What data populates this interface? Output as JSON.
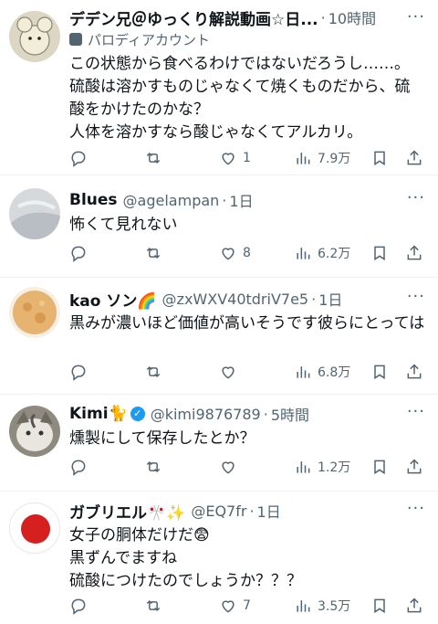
{
  "posts": [
    {
      "name": "デデン兄＠ゆっくり解説動画☆日...",
      "handle": "",
      "time": "10時間",
      "sub": "パロディアカウント",
      "text": "この状態から食べるわけではないだろうし……。\n硫酸は溶かすものじゃなくて焼くものだから、硫酸をかけたのかな？\n人体を溶かすなら酸じゃなくてアルカリ。",
      "replies": "",
      "reposts": "",
      "likes": "1",
      "views": "7.9万",
      "avatar_color": "#e8e0c8"
    },
    {
      "name": "Blues",
      "handle": "@agelampan",
      "time": "1日",
      "text": "怖くて見れない",
      "replies": "",
      "reposts": "",
      "likes": "8",
      "views": "6.2万",
      "avatar_color": "#c9cdd2"
    },
    {
      "name": "kao ソン🌈",
      "handle": "@zxWXV40tdriV7e5",
      "time": "1日",
      "text": "黒みが濃いほど価値が高いそうです彼らにとっては",
      "replies": "",
      "reposts": "",
      "likes": "",
      "views": "6.8万",
      "avatar_color": "#e8b768"
    },
    {
      "name": "Kimi🐈",
      "handle": "@kimi9876789",
      "time": "5時間",
      "text": "燻製にして保存したとか？",
      "replies": "",
      "reposts": "",
      "likes": "",
      "views": "1.2万",
      "avatar_color": "#9a9488"
    },
    {
      "name": "ガブリエル🎌✨",
      "handle": "@EQ7fr",
      "time": "1日",
      "text": "女子の胴体だけだ😨\n黒ずんでますね\n硫酸につけたのでしょうか？？？",
      "replies": "",
      "reposts": "",
      "likes": "7",
      "views": "3.5万",
      "avatar_color": "#d61f1f"
    }
  ],
  "more_label": "···",
  "icons": [
    "reply-icon",
    "repost-icon",
    "like-icon",
    "views-icon",
    "bookmark-icon",
    "share-icon",
    "parody-icon",
    "verified-icon"
  ],
  "colors": {
    "text": "#0f1419",
    "secondary": "#536471",
    "divider": "#eff3f4",
    "verified": "#1d9bf0"
  }
}
